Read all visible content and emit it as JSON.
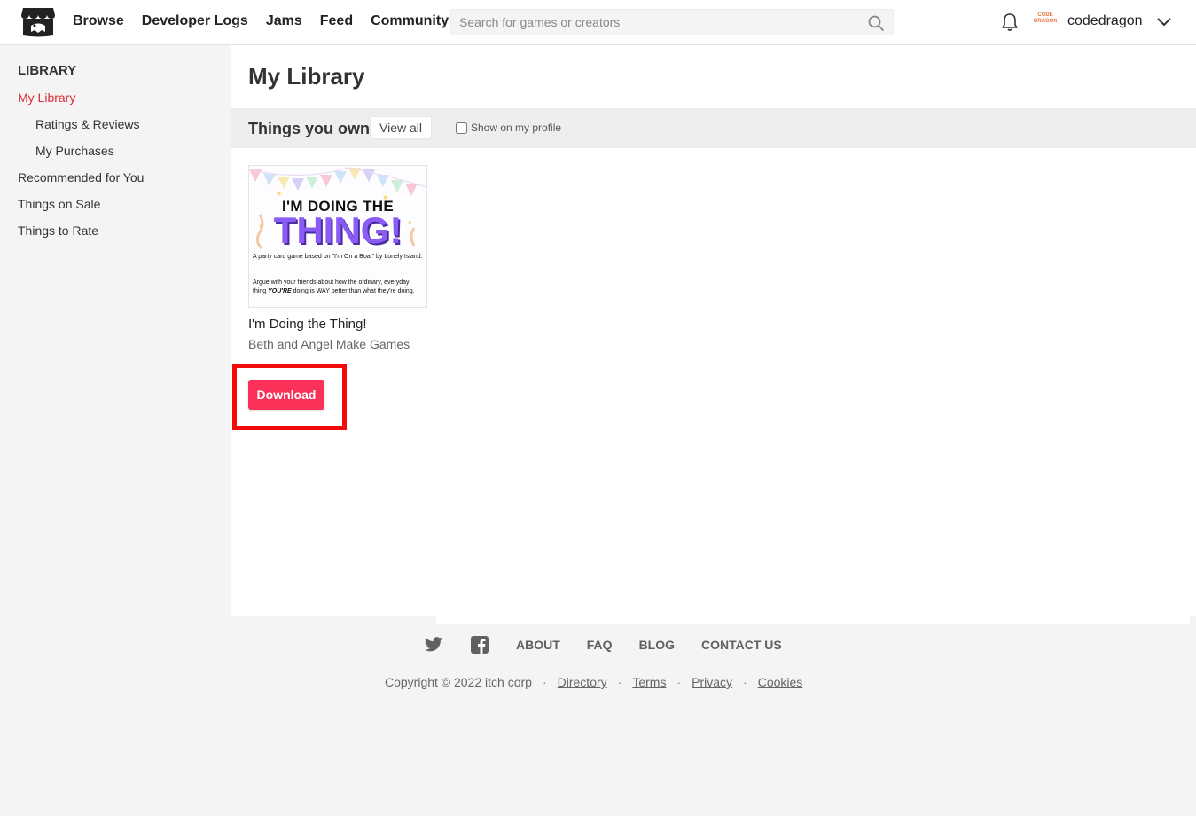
{
  "header": {
    "nav": [
      "Browse",
      "Developer Logs",
      "Jams",
      "Feed",
      "Community"
    ],
    "search_placeholder": "Search for games or creators",
    "username": "codedragon",
    "avatar_text": "CODE DRAGON"
  },
  "sidebar": {
    "heading": "LIBRARY",
    "items": [
      {
        "label": "My Library"
      },
      {
        "label": "Ratings & Reviews"
      },
      {
        "label": "My Purchases"
      },
      {
        "label": "Recommended for You"
      },
      {
        "label": "Things on Sale"
      },
      {
        "label": "Things to Rate"
      }
    ]
  },
  "main": {
    "title": "My Library",
    "section_title": "Things you own",
    "view_all": "View all",
    "show_profile": "Show on my profile",
    "game": {
      "cover_line1": "I'M DOING THE",
      "cover_line2": "THING!",
      "cover_desc1": "A party card game based on \"I'm On a Boat\" by Lonely Island.",
      "cover_desc2a": "Argue with your friends about how the ordinary, everyday thing ",
      "cover_desc2b": "YOU'RE",
      "cover_desc2c": " doing is WAY better than what they're doing.",
      "title": "I'm Doing the Thing!",
      "author": "Beth and Angel Make Games"
    },
    "download": "Download"
  },
  "footer": {
    "links": [
      "ABOUT",
      "FAQ",
      "BLOG",
      "CONTACT US"
    ],
    "copyright": "Copyright © 2022 itch corp",
    "legal": [
      "Directory",
      "Terms",
      "Privacy",
      "Cookies"
    ]
  },
  "colors": {
    "accent": "#fa325a",
    "active_nav": "#da2c38",
    "highlight_border": "#f00a0a",
    "cover_title": "#8a5cf5"
  }
}
